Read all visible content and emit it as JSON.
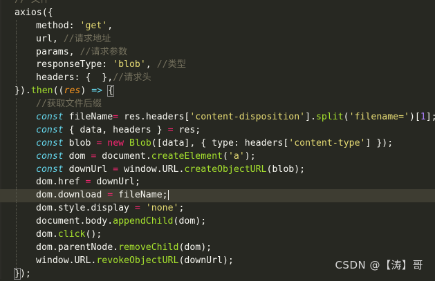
{
  "editor": {
    "current_line": 15,
    "lines": [
      {
        "indent": 0,
        "tokens": [
          {
            "t": "// 文件",
            "c": "comment"
          }
        ]
      },
      {
        "indent": 0,
        "tokens": [
          {
            "t": "axios",
            "c": "default"
          },
          {
            "t": "(",
            "c": "punct"
          },
          {
            "t": "{",
            "c": "punct"
          }
        ]
      },
      {
        "indent": 1,
        "tokens": [
          {
            "t": "method: ",
            "c": "default"
          },
          {
            "t": "'get'",
            "c": "string"
          },
          {
            "t": ",",
            "c": "punct"
          }
        ]
      },
      {
        "indent": 1,
        "tokens": [
          {
            "t": "url, ",
            "c": "default"
          },
          {
            "t": "//请求地址",
            "c": "comment"
          }
        ]
      },
      {
        "indent": 1,
        "tokens": [
          {
            "t": "params, ",
            "c": "default"
          },
          {
            "t": "//请求参数",
            "c": "comment"
          }
        ]
      },
      {
        "indent": 1,
        "tokens": [
          {
            "t": "responseType: ",
            "c": "default"
          },
          {
            "t": "'blob'",
            "c": "string"
          },
          {
            "t": ", ",
            "c": "punct"
          },
          {
            "t": "//类型",
            "c": "comment"
          }
        ]
      },
      {
        "indent": 1,
        "tokens": [
          {
            "t": "headers: { ",
            "c": "default"
          },
          {
            "t": " }",
            "c": "default"
          },
          {
            "t": ",",
            "c": "punct"
          },
          {
            "t": "//请求头",
            "c": "comment"
          }
        ]
      },
      {
        "indent": 0,
        "tokens": [
          {
            "t": "})",
            "c": "default"
          },
          {
            "t": ".",
            "c": "punct"
          },
          {
            "t": "then",
            "c": "function"
          },
          {
            "t": "((",
            "c": "punct"
          },
          {
            "t": "res",
            "c": "param"
          },
          {
            "t": ") ",
            "c": "punct"
          },
          {
            "t": "=>",
            "c": "keyword"
          },
          {
            "t": " ",
            "c": "default"
          },
          {
            "t": "{",
            "c": "brace"
          }
        ]
      },
      {
        "indent": 1,
        "tokens": [
          {
            "t": "//获取文件后缀",
            "c": "comment"
          }
        ]
      },
      {
        "indent": 1,
        "tokens": [
          {
            "t": "const",
            "c": "keyword"
          },
          {
            "t": " fileName",
            "c": "default"
          },
          {
            "t": "= ",
            "c": "operator"
          },
          {
            "t": "res.headers[",
            "c": "default"
          },
          {
            "t": "'content-disposition'",
            "c": "string"
          },
          {
            "t": "].",
            "c": "default"
          },
          {
            "t": "split",
            "c": "function"
          },
          {
            "t": "(",
            "c": "punct"
          },
          {
            "t": "'filename='",
            "c": "string"
          },
          {
            "t": ")[",
            "c": "punct"
          },
          {
            "t": "1",
            "c": "number"
          },
          {
            "t": "];",
            "c": "punct"
          }
        ]
      },
      {
        "indent": 1,
        "tokens": [
          {
            "t": "const",
            "c": "keyword"
          },
          {
            "t": " { data, headers } ",
            "c": "default"
          },
          {
            "t": "=",
            "c": "operator"
          },
          {
            "t": " res;",
            "c": "default"
          }
        ]
      },
      {
        "indent": 1,
        "tokens": [
          {
            "t": "const",
            "c": "keyword"
          },
          {
            "t": " blob ",
            "c": "default"
          },
          {
            "t": "=",
            "c": "operator"
          },
          {
            "t": " ",
            "c": "default"
          },
          {
            "t": "new",
            "c": "new"
          },
          {
            "t": " ",
            "c": "default"
          },
          {
            "t": "Blob",
            "c": "function"
          },
          {
            "t": "([data], { type: headers[",
            "c": "default"
          },
          {
            "t": "'content-type'",
            "c": "string"
          },
          {
            "t": "] });",
            "c": "default"
          }
        ]
      },
      {
        "indent": 1,
        "tokens": [
          {
            "t": "const",
            "c": "keyword"
          },
          {
            "t": " dom ",
            "c": "default"
          },
          {
            "t": "=",
            "c": "operator"
          },
          {
            "t": " document.",
            "c": "default"
          },
          {
            "t": "createElement",
            "c": "function"
          },
          {
            "t": "(",
            "c": "punct"
          },
          {
            "t": "'a'",
            "c": "string"
          },
          {
            "t": ");",
            "c": "punct"
          }
        ]
      },
      {
        "indent": 1,
        "tokens": [
          {
            "t": "const",
            "c": "keyword"
          },
          {
            "t": " downUrl ",
            "c": "default"
          },
          {
            "t": "=",
            "c": "operator"
          },
          {
            "t": " window.URL.",
            "c": "default"
          },
          {
            "t": "createObjectURL",
            "c": "function"
          },
          {
            "t": "(blob);",
            "c": "default"
          }
        ]
      },
      {
        "indent": 1,
        "tokens": [
          {
            "t": "dom.href ",
            "c": "default"
          },
          {
            "t": "=",
            "c": "operator"
          },
          {
            "t": " downUrl;",
            "c": "default"
          }
        ]
      },
      {
        "indent": 1,
        "tokens": [
          {
            "t": "dom.download ",
            "c": "default"
          },
          {
            "t": "=",
            "c": "operator"
          },
          {
            "t": " fileName;",
            "c": "default"
          }
        ],
        "caret": true
      },
      {
        "indent": 1,
        "tokens": [
          {
            "t": "dom.style.display ",
            "c": "default"
          },
          {
            "t": "=",
            "c": "operator"
          },
          {
            "t": " ",
            "c": "default"
          },
          {
            "t": "'none'",
            "c": "string"
          },
          {
            "t": ";",
            "c": "punct"
          }
        ]
      },
      {
        "indent": 1,
        "tokens": [
          {
            "t": "document.body.",
            "c": "default"
          },
          {
            "t": "appendChild",
            "c": "function"
          },
          {
            "t": "(dom);",
            "c": "default"
          }
        ]
      },
      {
        "indent": 1,
        "tokens": [
          {
            "t": "dom.",
            "c": "default"
          },
          {
            "t": "click",
            "c": "function"
          },
          {
            "t": "();",
            "c": "punct"
          }
        ]
      },
      {
        "indent": 1,
        "tokens": [
          {
            "t": "dom.parentNode.",
            "c": "default"
          },
          {
            "t": "removeChild",
            "c": "function"
          },
          {
            "t": "(dom);",
            "c": "default"
          }
        ]
      },
      {
        "indent": 1,
        "tokens": [
          {
            "t": "window.URL.",
            "c": "default"
          },
          {
            "t": "revokeObjectURL",
            "c": "function"
          },
          {
            "t": "(downUrl);",
            "c": "default"
          }
        ]
      },
      {
        "indent": 0,
        "tokens": [
          {
            "t": "}",
            "c": "brace"
          },
          {
            "t": ");",
            "c": "punct"
          }
        ]
      }
    ]
  },
  "watermark": "CSDN @【涛】哥",
  "colors": {
    "background": "#272822",
    "current_line": "#3e3d32",
    "keyword": "#66d9ef",
    "string": "#e6db74",
    "comment": "#75715e",
    "function": "#a6e22e",
    "param": "#fd971f",
    "number": "#ae81ff",
    "operator": "#f92672"
  }
}
